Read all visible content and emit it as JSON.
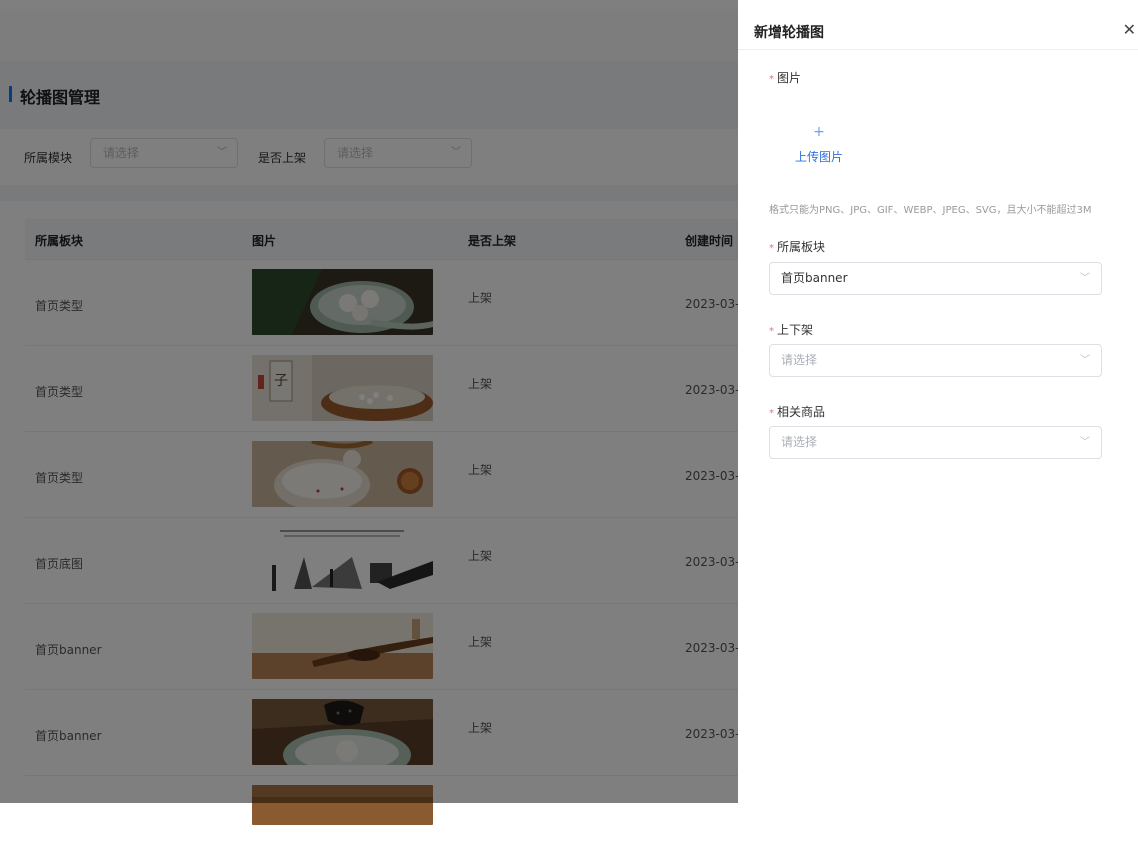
{
  "page": {
    "title": "轮播图管理",
    "filters": {
      "module_label": "所属模块",
      "module_placeholder": "请选择",
      "shelf_label": "是否上架",
      "shelf_placeholder": "请选择"
    },
    "table": {
      "columns": [
        "所属板块",
        "图片",
        "是否上架",
        "创建时间"
      ],
      "rows": [
        {
          "block": "首页类型",
          "image": "tangyuan-bowl-photo",
          "status": "上架",
          "created": "2023-03-"
        },
        {
          "block": "首页类型",
          "image": "rice-bag-bowl-photo",
          "status": "上架",
          "created": "2023-03-"
        },
        {
          "block": "首页类型",
          "image": "rice-spoon-photo",
          "status": "上架",
          "created": "2023-03-"
        },
        {
          "block": "首页底图",
          "image": "ink-sketch-banner",
          "status": "上架",
          "created": "2023-03-"
        },
        {
          "block": "首页banner",
          "image": "spoon-wood-photo",
          "status": "上架",
          "created": "2023-03-"
        },
        {
          "block": "首页banner",
          "image": "black-sesame-photo",
          "status": "上架",
          "created": "2023-03-"
        }
      ]
    }
  },
  "drawer": {
    "title": "新增轮播图",
    "close_icon": "close-icon",
    "image_label": "图片",
    "upload_plus": "+",
    "upload_text": "上传图片",
    "format_hint": "格式只能为PNG、JPG、GIF、WEBP、JPEG、SVG，且大小不能超过3M",
    "block_label": "所属板块",
    "block_value": "首页banner",
    "shelf_label": "上下架",
    "shelf_placeholder": "请选择",
    "product_label": "相关商品",
    "product_placeholder": "请选择",
    "required_mark": "*"
  },
  "colors": {
    "accent": "#1677ff",
    "required": "#f56c6c",
    "overlay": "rgba(0,0,0,0.5)"
  }
}
